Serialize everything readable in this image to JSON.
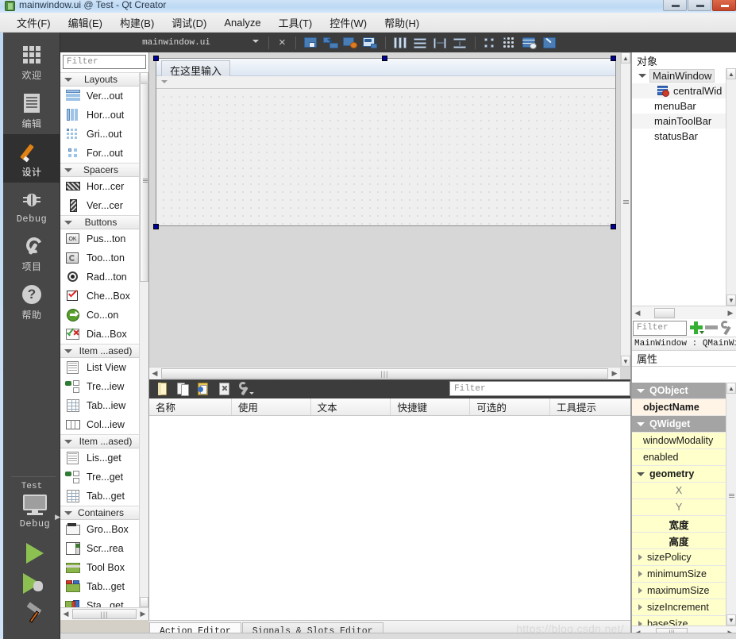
{
  "window": {
    "title": "mainwindow.ui @ Test - Qt Creator",
    "app_icon": "qt-creator-icon",
    "minimize_label": "",
    "maximize_label": "",
    "close_label": ""
  },
  "menubar": {
    "items": [
      {
        "label": "文件(F)",
        "name": "menu-file"
      },
      {
        "label": "编辑(E)",
        "name": "menu-edit"
      },
      {
        "label": "构建(B)",
        "name": "menu-build"
      },
      {
        "label": "调试(D)",
        "name": "menu-debug"
      },
      {
        "label": "Analyze",
        "name": "menu-analyze"
      },
      {
        "label": "工具(T)",
        "name": "menu-tools"
      },
      {
        "label": "控件(W)",
        "name": "menu-window"
      },
      {
        "label": "帮助(H)",
        "name": "menu-help"
      }
    ]
  },
  "modebar": {
    "modes": [
      {
        "label": "欢迎",
        "icon": "grid-icon",
        "active": false
      },
      {
        "label": "编辑",
        "icon": "document-icon",
        "active": false
      },
      {
        "label": "设计",
        "icon": "pencil-icon",
        "active": true
      },
      {
        "label": "Debug",
        "icon": "bug-icon",
        "active": false
      },
      {
        "label": "项目",
        "icon": "wrench-icon",
        "active": false
      },
      {
        "label": "帮助",
        "icon": "help-icon",
        "active": false
      }
    ],
    "kit_label": "Test",
    "build_config_label": "Debug",
    "run_button_name": "run-button",
    "debug_button_name": "start-debugging-button",
    "build_button_name": "build-button"
  },
  "editor_toolbar": {
    "open_file": "mainwindow.ui",
    "close_label": "×",
    "buttons": [
      {
        "name": "edit-widgets-button"
      },
      {
        "name": "edit-signals-slots-button"
      },
      {
        "name": "edit-buddies-button"
      },
      {
        "name": "edit-tab-order-button"
      },
      {
        "name": "layout-horizontally-button"
      },
      {
        "name": "layout-vertically-button"
      },
      {
        "name": "layout-splitter-horizontal-button"
      },
      {
        "name": "layout-splitter-vertical-button"
      },
      {
        "name": "layout-form-button"
      },
      {
        "name": "layout-grid-button"
      },
      {
        "name": "break-layout-button"
      },
      {
        "name": "adjust-size-button"
      }
    ]
  },
  "widgetbox": {
    "filter_placeholder": "Filter",
    "groups": [
      {
        "title": "Layouts",
        "items": [
          {
            "label": "Ver...out",
            "icon": "vertical-layout-icon"
          },
          {
            "label": "Hor...out",
            "icon": "horizontal-layout-icon"
          },
          {
            "label": "Gri...out",
            "icon": "grid-layout-icon"
          },
          {
            "label": "For...out",
            "icon": "form-layout-icon"
          }
        ]
      },
      {
        "title": "Spacers",
        "items": [
          {
            "label": "Hor...cer",
            "icon": "horizontal-spacer-icon"
          },
          {
            "label": "Ver...cer",
            "icon": "vertical-spacer-icon"
          }
        ]
      },
      {
        "title": "Buttons",
        "items": [
          {
            "label": "Pus...ton",
            "icon": "push-button-icon"
          },
          {
            "label": "Too...ton",
            "icon": "tool-button-icon"
          },
          {
            "label": "Rad...ton",
            "icon": "radio-button-icon"
          },
          {
            "label": "Che...Box",
            "icon": "check-box-icon"
          },
          {
            "label": "Co...on",
            "icon": "command-link-button-icon"
          },
          {
            "label": "Dia...Box",
            "icon": "dialog-button-box-icon"
          }
        ]
      },
      {
        "title": "Item ...ased)",
        "items": [
          {
            "label": "List View",
            "icon": "list-view-icon"
          },
          {
            "label": "Tre...iew",
            "icon": "tree-view-icon"
          },
          {
            "label": "Tab...iew",
            "icon": "table-view-icon"
          },
          {
            "label": "Col...iew",
            "icon": "column-view-icon"
          }
        ]
      },
      {
        "title": "Item ...ased)",
        "items": [
          {
            "label": "Lis...get",
            "icon": "list-widget-icon"
          },
          {
            "label": "Tre...get",
            "icon": "tree-widget-icon"
          },
          {
            "label": "Tab...get",
            "icon": "table-widget-icon"
          }
        ]
      },
      {
        "title": "Containers",
        "items": [
          {
            "label": "Gro...Box",
            "icon": "group-box-icon"
          },
          {
            "label": "Scr...rea",
            "icon": "scroll-area-icon"
          },
          {
            "label": "Tool Box",
            "icon": "tool-box-icon"
          },
          {
            "label": "Tab...get",
            "icon": "tab-widget-icon"
          },
          {
            "label": "Sta...get",
            "icon": "stacked-widget-icon"
          }
        ]
      }
    ]
  },
  "canvas": {
    "form_menubar_placeholder": "在这里输入",
    "selection_handles": 6
  },
  "action_editor": {
    "filter_placeholder": "Filter",
    "toolbar_buttons": [
      {
        "name": "new-action-button"
      },
      {
        "name": "copy-action-button"
      },
      {
        "name": "paste-action-button"
      },
      {
        "name": "delete-action-button"
      },
      {
        "name": "action-settings-button"
      }
    ],
    "columns": [
      "名称",
      "使用",
      "文本",
      "快捷键",
      "可选的",
      "工具提示"
    ],
    "rows": [],
    "tabs": [
      {
        "label": "Action Editor",
        "active": true
      },
      {
        "label": "Signals & Slots Editor",
        "active": false
      }
    ],
    "watermark": "https://blog.csdn.net/"
  },
  "object_inspector": {
    "title": "对象",
    "rows": [
      {
        "label": "MainWindow",
        "indent": 0,
        "expander": true,
        "icon": "",
        "selected": true
      },
      {
        "label": "centralWid",
        "indent": 2,
        "expander": false,
        "icon": "central-widget-icon",
        "selected": false
      },
      {
        "label": "menuBar",
        "indent": 1,
        "expander": false,
        "icon": "",
        "selected": false
      },
      {
        "label": "mainToolBar",
        "indent": 1,
        "expander": false,
        "icon": "",
        "selected": false
      },
      {
        "label": "statusBar",
        "indent": 1,
        "expander": false,
        "icon": "",
        "selected": false
      }
    ]
  },
  "property_editor": {
    "filter_placeholder": "Filter",
    "add_button_name": "add-dynamic-property-button",
    "remove_button_name": "remove-dynamic-property-button",
    "configure_button_name": "configure-property-editor-button",
    "object_line": "MainWindow : QMainWin",
    "header": "属性",
    "rows": [
      {
        "label": "QObject",
        "kind": "group"
      },
      {
        "label": "objectName",
        "kind": "groupw"
      },
      {
        "label": "QWidget",
        "kind": "group"
      },
      {
        "label": "windowModality",
        "kind": "sub"
      },
      {
        "label": "enabled",
        "kind": "sub"
      },
      {
        "label": "geometry",
        "kind": "geom"
      },
      {
        "label": "X",
        "kind": "subc"
      },
      {
        "label": "Y",
        "kind": "subc"
      },
      {
        "label": "宽度",
        "kind": "subb"
      },
      {
        "label": "高度",
        "kind": "subb"
      },
      {
        "label": "sizePolicy",
        "kind": "exp"
      },
      {
        "label": "minimumSize",
        "kind": "exp"
      },
      {
        "label": "maximumSize",
        "kind": "exp"
      },
      {
        "label": "sizeIncrement",
        "kind": "exp"
      },
      {
        "label": "baseSize",
        "kind": "exp"
      }
    ]
  },
  "colors": {
    "accent_selection": "#00009b",
    "mode_active_bg": "#303030",
    "toolbar_bg": "#3c3c3c",
    "property_group_bg": "#a4a4a4",
    "property_value_bg": "#ffffcc",
    "title_bar": "#bcd8f3"
  }
}
